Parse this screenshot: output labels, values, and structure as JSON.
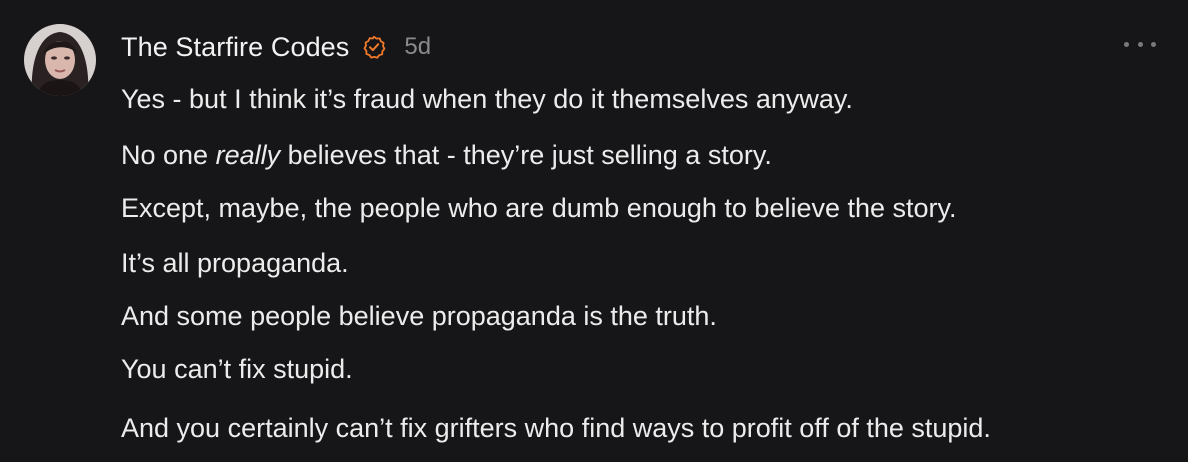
{
  "post": {
    "author": "The Starfire Codes",
    "verified_icon": "verified-check-icon",
    "time": "5d",
    "more_icon": "more-dots-icon",
    "accent_color": "#f07a2a",
    "lines": [
      "Yes - but I think it’s fraud when they do it themselves anyway.",
      {
        "pre": "No one ",
        "em": "really",
        "post": " believes that - they’re just selling a story."
      },
      "Except, maybe, the people who are dumb enough to believe the story.",
      "It’s all propaganda.",
      "And some people believe propaganda is the truth.",
      "You can’t fix stupid.",
      "And you certainly can’t fix grifters who find ways to profit off of the stupid."
    ]
  }
}
